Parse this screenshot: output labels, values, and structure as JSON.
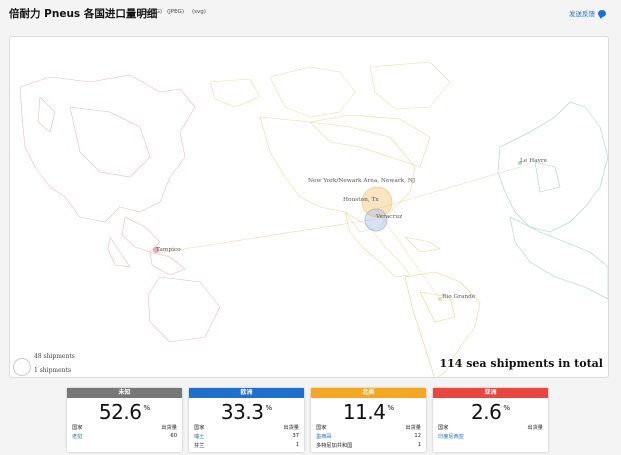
{
  "header": {
    "title": "倍耐力 Pneus 各国进口量明细",
    "download_png": "(PNG)",
    "download_jpeg": "(JPEG)",
    "download_svg": "(svg)",
    "feedback_label": "发送反馈"
  },
  "map": {
    "ports": [
      {
        "name": "New York/Newark Area, Newark, NJ"
      },
      {
        "name": "Houston, Tx"
      },
      {
        "name": "Veracruz"
      },
      {
        "name": "Tampico"
      },
      {
        "name": "Le Havre"
      },
      {
        "name": "Rio Grande"
      }
    ],
    "legend": {
      "large_label": "48 shipments",
      "small_label": "1 shipments"
    },
    "total_label": "114 sea shipments in total",
    "colors": {
      "north_america": "#f3b54a",
      "asia": "#e8505b",
      "europe": "#7fb8a4",
      "south_america": "#d8cf7a"
    }
  },
  "regions": [
    {
      "name": "未知",
      "color": "#777777",
      "percent": "52.6",
      "percent_sign": "%",
      "col_country": "国家",
      "col_volume": "出货量",
      "rows": [
        {
          "country": "老挝",
          "volume": "60",
          "link": true
        }
      ]
    },
    {
      "name": "欧洲",
      "color": "#1f6fd1",
      "percent": "33.3",
      "percent_sign": "%",
      "col_country": "国家",
      "col_volume": "出货量",
      "rows": [
        {
          "country": "瑞士",
          "volume": "37",
          "link": true
        },
        {
          "country": "芬兰",
          "volume": "1",
          "link": false
        }
      ]
    },
    {
      "name": "北美",
      "color": "#f5a623",
      "percent": "11.4",
      "percent_sign": "%",
      "col_country": "国家",
      "col_volume": "出货量",
      "rows": [
        {
          "country": "墨西哥",
          "volume": "12",
          "link": true
        },
        {
          "country": "多特尼加共和国",
          "volume": "1",
          "link": false
        }
      ]
    },
    {
      "name": "亚洲",
      "color": "#e84545",
      "percent": "2.6",
      "percent_sign": "%",
      "col_country": "国家",
      "col_volume": "出货量",
      "rows": [
        {
          "country": "印度尼西亚",
          "volume": "",
          "link": true
        }
      ]
    }
  ]
}
